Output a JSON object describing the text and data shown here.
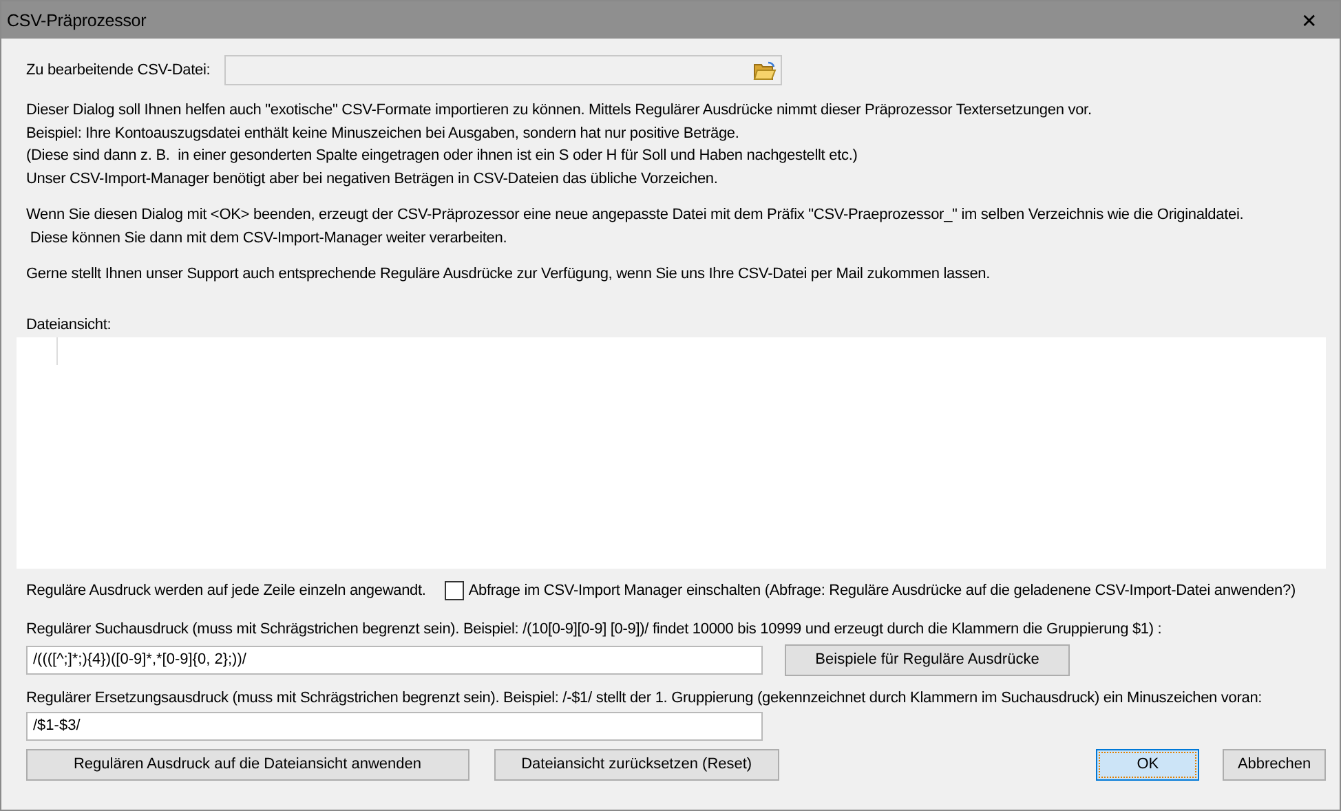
{
  "window": {
    "title": "CSV-Präprozessor",
    "close": "✕"
  },
  "file_field": {
    "label": "Zu bearbeitende CSV-Datei:"
  },
  "description": [
    [
      "Dieser Dialog soll Ihnen helfen auch \"exotische\" CSV-Formate importieren zu können. Mittels Regulärer Ausdrücke nimmt dieser Präprozessor Textersetzungen vor.",
      "Beispiel: Ihre Kontoauszugsdatei enthält keine Minuszeichen bei Ausgaben, sondern hat nur positive Beträge.",
      "(Diese sind dann z. B.  in einer gesonderten Spalte eingetragen oder ihnen ist ein S oder H für Soll und Haben nachgestellt etc.)",
      "Unser CSV-Import-Manager benötigt aber bei negativen Beträgen in CSV-Dateien das übliche Vorzeichen."
    ],
    [
      "Wenn Sie diesen Dialog mit <OK> beenden, erzeugt der CSV-Präprozessor eine neue angepasste Datei mit dem Präfix \"CSV-Praeprozessor_\" im selben Verzeichnis wie die Originaldatei.",
      " Diese können Sie dann mit dem CSV-Import-Manager weiter verarbeiten."
    ],
    [
      "Gerne stellt Ihnen unser Support auch entsprechende Reguläre Ausdrücke zur Verfügung, wenn Sie uns Ihre CSV-Datei per Mail zukommen lassen."
    ]
  ],
  "file_view": {
    "label": "Dateiansicht:"
  },
  "note": "Reguläre Ausdruck werden auf jede Zeile einzeln angewandt.",
  "checkbox": {
    "label": "Abfrage im CSV-Import Manager einschalten (Abfrage: Reguläre Ausdrücke auf die geladenene CSV-Import-Datei anwenden?)",
    "checked": false
  },
  "search": {
    "label": "Regulärer Suchausdruck (muss mit Schrägstrichen begrenzt sein). Beispiel: /(10[0-9][0-9] [0-9])/ findet 10000 bis 10999 und erzeugt durch die Klammern die Gruppierung $1) :",
    "value": "/((([^;]*;){4})([0-9]*,*[0-9]{0, 2};))/",
    "button": "Beispiele für Reguläre Ausdrücke"
  },
  "replace": {
    "label": "Regulärer Ersetzungsausdruck (muss mit Schrägstrichen begrenzt sein). Beispiel: /-$1/ stellt der 1. Gruppierung (gekennzeichnet durch Klammern im Suchausdruck) ein Minuszeichen voran:",
    "value": "/$1-$3/"
  },
  "buttons": [
    {
      "label": "Regulären Ausdruck auf die Dateiansicht anwenden",
      "selected": false
    },
    {
      "label": "Dateiansicht zurücksetzen (Reset)",
      "selected": false
    },
    {
      "label": "OK",
      "selected": true
    },
    {
      "label": "Abbrechen",
      "selected": false
    }
  ]
}
